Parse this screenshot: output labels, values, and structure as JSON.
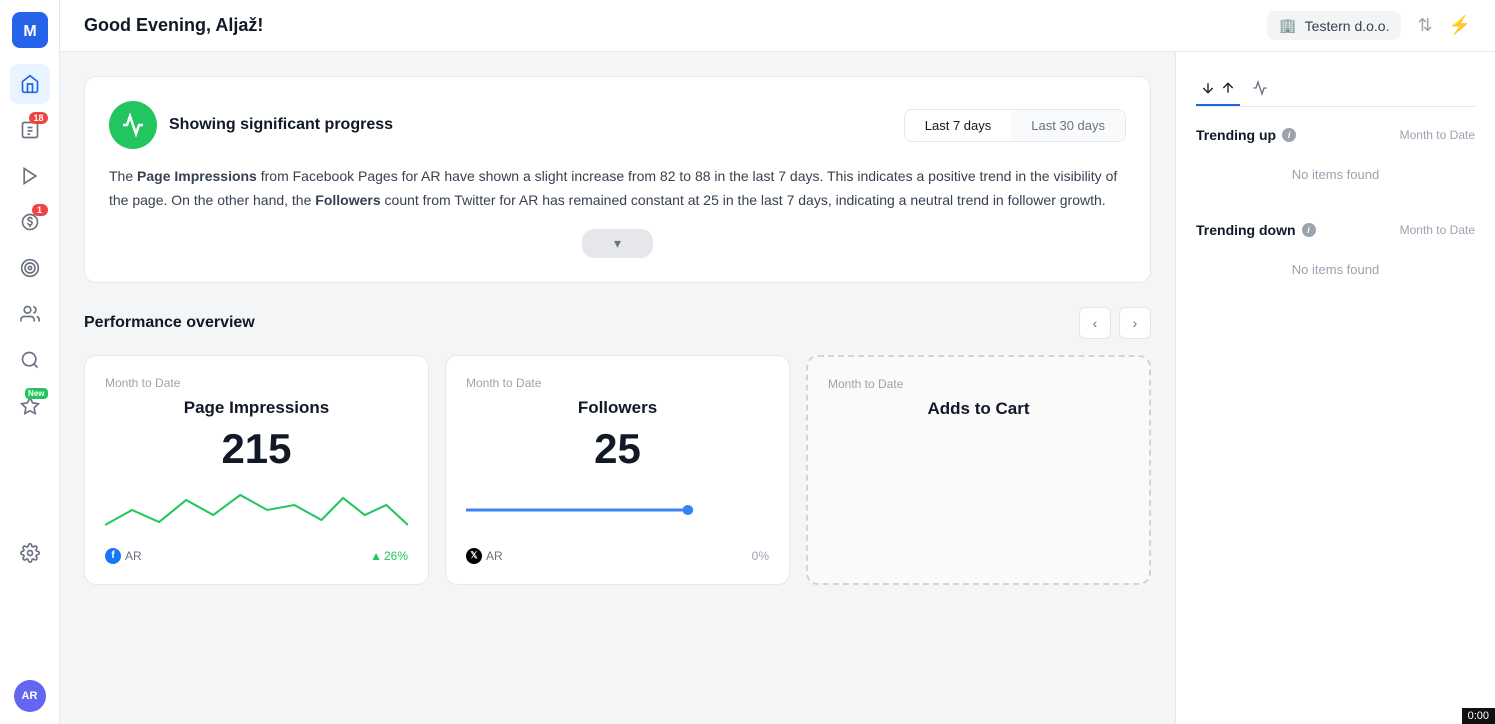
{
  "app": {
    "logo_text": "M",
    "greeting": "Good Evening, Aljaž!",
    "org_name": "Testern d.o.o.",
    "org_icon": "🏢"
  },
  "sidebar": {
    "items": [
      {
        "id": "home",
        "icon": "⌂",
        "active": true,
        "badge": null
      },
      {
        "id": "reports",
        "icon": "📊",
        "active": false,
        "badge": "18"
      },
      {
        "id": "video",
        "icon": "▶",
        "active": false,
        "badge": null
      },
      {
        "id": "budget",
        "icon": "💰",
        "active": false,
        "badge": "1"
      },
      {
        "id": "goals",
        "icon": "🎯",
        "active": false,
        "badge": null
      },
      {
        "id": "audience",
        "icon": "👥",
        "active": false,
        "badge": null
      },
      {
        "id": "search",
        "icon": "🔍",
        "active": false,
        "badge": null
      },
      {
        "id": "new-feature",
        "icon": "✦",
        "active": false,
        "badge": "New"
      }
    ],
    "avatar": "AR"
  },
  "topbar": {
    "title": "Good Evening, Aljaž!",
    "org": "Testern d.o.o.",
    "sort_icon": "⇅",
    "activity_icon": "⚡"
  },
  "progress_card": {
    "icon": "⚡",
    "label": "Showing significant progress",
    "tabs": [
      {
        "label": "Last 7 days",
        "active": true
      },
      {
        "label": "Last 30 days",
        "active": false
      }
    ],
    "text_parts": [
      {
        "type": "text",
        "value": "The "
      },
      {
        "type": "bold",
        "value": "Page Impressions"
      },
      {
        "type": "text",
        "value": " from Facebook Pages for AR have shown a slight increase from 82 to 88 in the last 7 days. This indicates a positive trend in the visibility of the page. On the other hand, the "
      },
      {
        "type": "bold",
        "value": "Followers"
      },
      {
        "type": "text",
        "value": " count from Twitter for AR has remained constant at 25 in the last 7 days, indicating a neutral trend in follower growth."
      }
    ],
    "expand_label": "▾"
  },
  "performance": {
    "title": "Performance overview",
    "cards": [
      {
        "id": "page-impressions",
        "date_label": "Month to Date",
        "name": "Page Impressions",
        "value": "215",
        "source": "AR",
        "source_type": "facebook",
        "pct": "26%",
        "pct_direction": "up",
        "chart_type": "line",
        "chart_color": "#22c55e"
      },
      {
        "id": "followers",
        "date_label": "Month to Date",
        "name": "Followers",
        "value": "25",
        "source": "AR",
        "source_type": "twitter",
        "pct": "0%",
        "pct_direction": "neutral",
        "chart_type": "flat",
        "chart_color": "#3b82f6"
      },
      {
        "id": "adds-to-cart",
        "date_label": "Month to Date",
        "name": "Adds to Cart",
        "value": "",
        "source": "",
        "source_type": "",
        "pct": "",
        "pct_direction": "",
        "chart_type": "none",
        "chart_color": ""
      }
    ]
  },
  "right_panel": {
    "tabs": [
      {
        "label": "⇅",
        "active": true
      },
      {
        "label": "⚡",
        "active": false
      }
    ],
    "trending_up": {
      "title": "Trending up",
      "date_label": "Month to Date",
      "no_items": "No items found"
    },
    "trending_down": {
      "title": "Trending down",
      "date_label": "Month to Date",
      "no_items": "No items found"
    }
  },
  "timer": "0:00"
}
